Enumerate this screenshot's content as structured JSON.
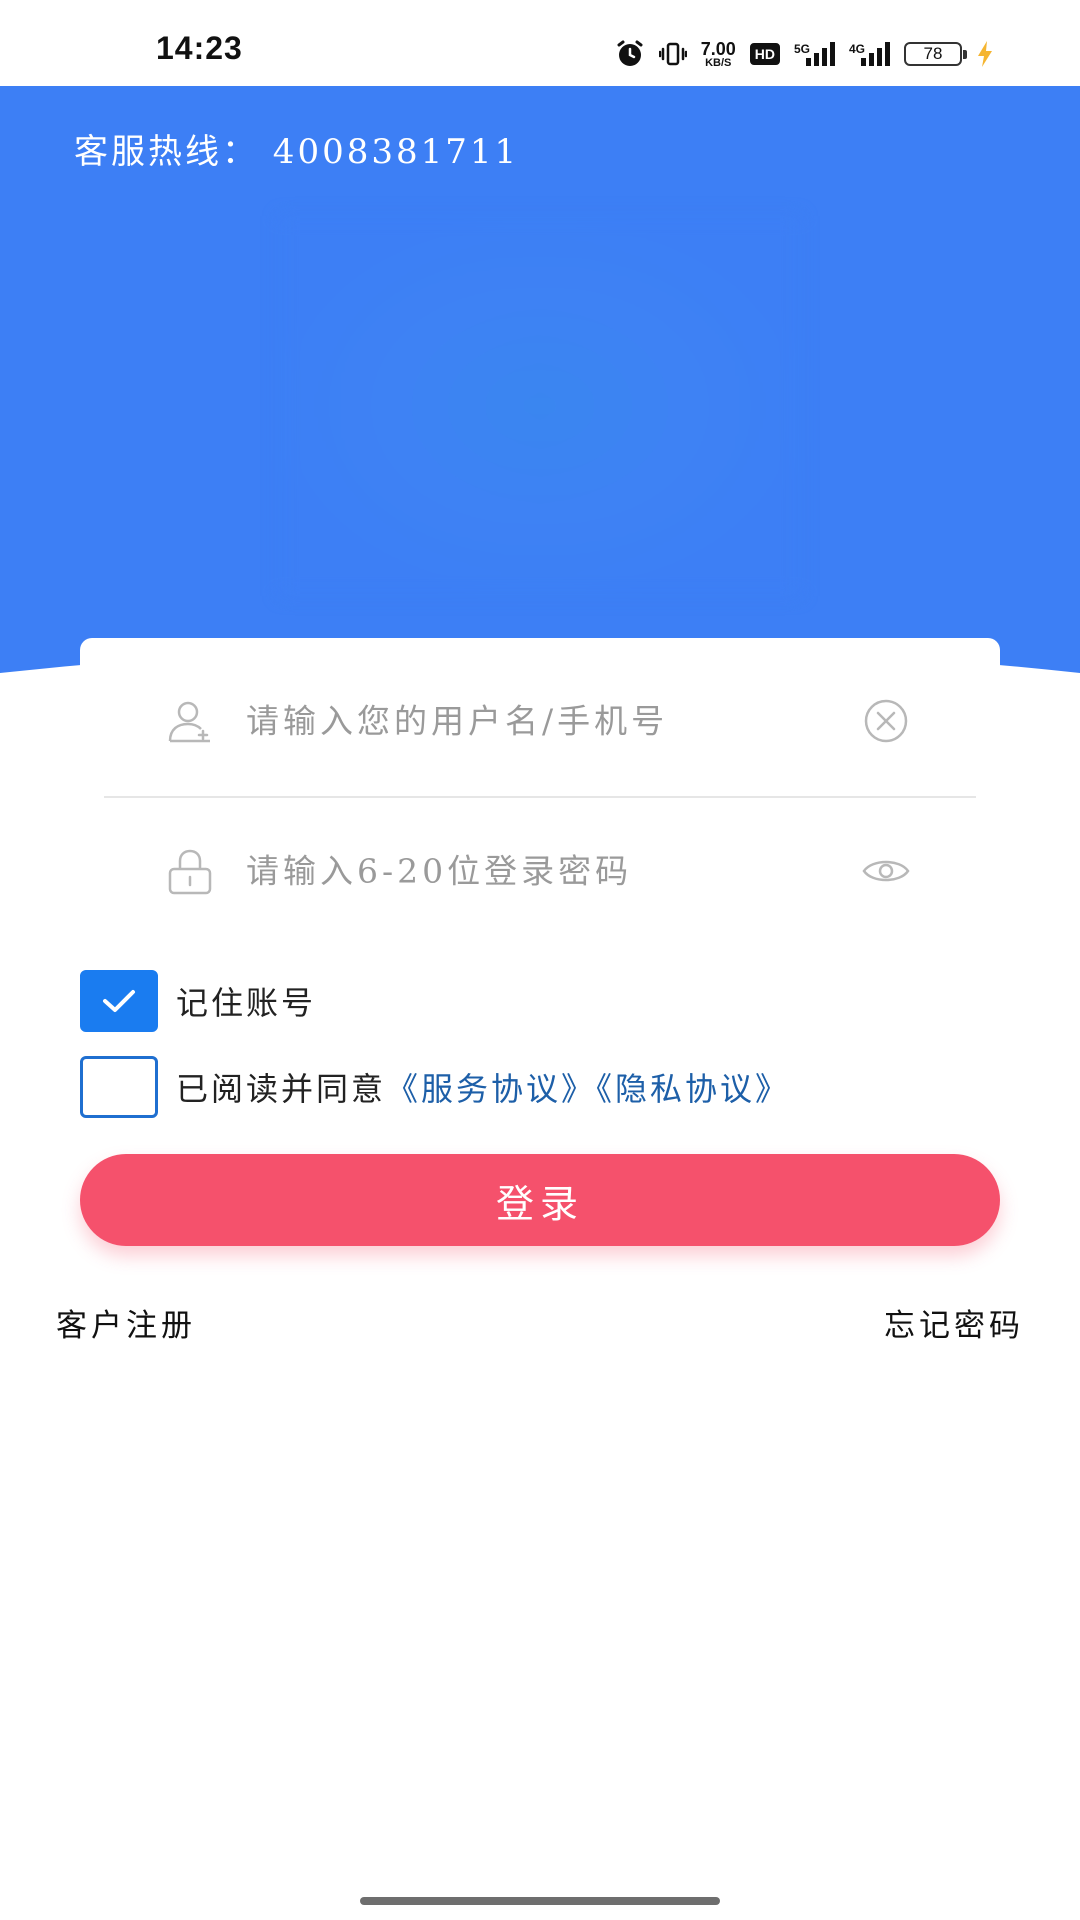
{
  "status_bar": {
    "time": "14:23",
    "net_speed_value": "7.00",
    "net_speed_unit": "KB/S",
    "hd_label": "HD",
    "signal1_label": "5G",
    "signal2_label": "4G",
    "battery_level": "78",
    "icons": [
      "alarm-icon",
      "vibrate-icon",
      "signal-icon",
      "battery-icon",
      "charging-icon"
    ]
  },
  "header": {
    "hotline": "客服热线： 4008381711",
    "background_color": "#3d7ff5"
  },
  "form": {
    "username_placeholder": "请输入您的用户名/手机号",
    "username_value": "",
    "password_placeholder": "请输入6-20位登录密码",
    "password_value": "",
    "remember_label": "记住账号",
    "remember_checked": true,
    "agree_prefix": "已阅读并同意",
    "agree_checked": false,
    "service_agreement": "《服务协议》",
    "privacy_agreement": "《隐私协议》",
    "login_label": "登录"
  },
  "links": {
    "register": "客户注册",
    "forgot_password": "忘记密码"
  },
  "colors": {
    "accent_blue": "#3d7ff5",
    "checkbox_blue": "#1a7cf0",
    "login_red": "#f5516c",
    "link_blue": "#1d5fa8"
  }
}
